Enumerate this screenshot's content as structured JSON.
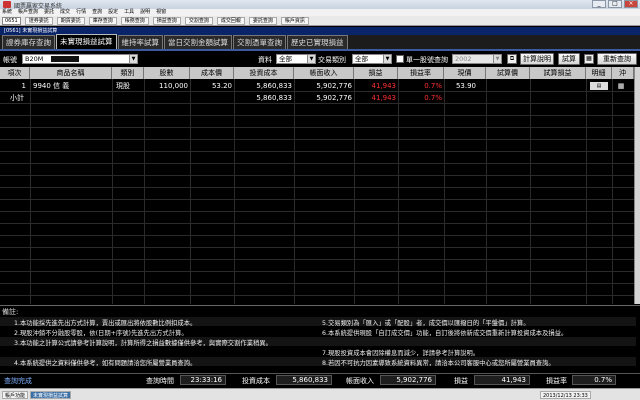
{
  "window": {
    "title": "國票贏家交易系統",
    "menu": [
      "系統",
      "帳戶查詢",
      "委託",
      "成交",
      "行情",
      "查詢",
      "設定",
      "工具",
      "說明",
      "視窗"
    ],
    "toolbar_account": "0651",
    "toolbar_buttons": [
      "證券委託",
      "期貨委託",
      "庫存查詢",
      "帳務查詢",
      "損益查詢",
      "交割查詢",
      "成交回報",
      "委託查詢",
      "帳戶資訊"
    ],
    "child_title": "[0561] 未實現損益試算"
  },
  "tabs": [
    "證券庫存查詢",
    "未實現損益試算",
    "維持率試算",
    "當日交割金額試算",
    "交割憑單查詢",
    "歷史已實現損益"
  ],
  "active_tab": 1,
  "filter": {
    "account_label": "帳號",
    "account_value": "B20M",
    "source_label": "資料",
    "source_value": "全部",
    "type_label": "交易類別",
    "type_value": "全部",
    "single_stock_label": "單一股號查詢",
    "year_value": "2002",
    "calc_button": "計算說明",
    "trial_button": "試算",
    "requery_button": "重新查詢"
  },
  "table": {
    "columns": [
      "項次",
      "商品名稱",
      "類別",
      "股數",
      "成本價",
      "投資成本",
      "帳面收入",
      "損益",
      "損益率",
      "現價",
      "試算價",
      "試算損益",
      "明細",
      "沖"
    ],
    "rows": [
      {
        "no": "1",
        "name": "9940 信 義",
        "type": "現股",
        "shares": "110,000",
        "cost_price": "53.20",
        "cost": "5,860,833",
        "income": "5,902,776",
        "pnl": "41,943",
        "rate": "0.7%",
        "price": "53.90",
        "trial_price": "",
        "trial_pnl": ""
      }
    ],
    "subtotal": {
      "label": "小計",
      "cost": "5,860,833",
      "income": "5,902,776",
      "pnl": "41,943",
      "rate": "0.7%"
    }
  },
  "notes": {
    "title": "備註:",
    "items": [
      "1.本功能採先進先出方式計算，賣出或匯出將依股數比例扣成本。",
      "2.現股沖銷不分融股零股，依(日期+序號)先進先出方式計算。",
      "3.本功能之計算公式請參考計算說明，計算所得之損益數據僅供參考，與實際交割作業稍異。",
      "4.本系統提供之資料僅供參考，如有問題請洽您所屬營業員查詢。",
      "5.交易類別為「匯入」或「配股」者，成交價以匯撥日的「平盤價」計算。",
      "6.本系統提供現股「自訂成交價」功能，自訂後將依新成交價重新計算投資成本及損益。",
      "7.現股投資成本會因除權息而減少，詳請參考計算說明。",
      "8.若因不可抗力因素導致系統資料異常，請洽本公司客服中心或您所屬營業員查詢。"
    ]
  },
  "summary": {
    "status": "查詢完成",
    "time_label": "查詢時間",
    "time_value": "23:33:16",
    "cost_label": "投資成本",
    "cost_value": "5,860,833",
    "income_label": "帳面收入",
    "income_value": "5,902,776",
    "pnl_label": "損益",
    "pnl_value": "41,943",
    "rate_label": "損益率",
    "rate_value": "0.7%"
  },
  "statusbar": {
    "left": "帳戶功能",
    "left2": "未實現損益試算",
    "datetime": "2013/12/13 23:33"
  },
  "colors": {
    "loss_profit": "#ff3030",
    "header_bg": "#c8c8c8",
    "tab_underline": "#3c5aa0"
  }
}
